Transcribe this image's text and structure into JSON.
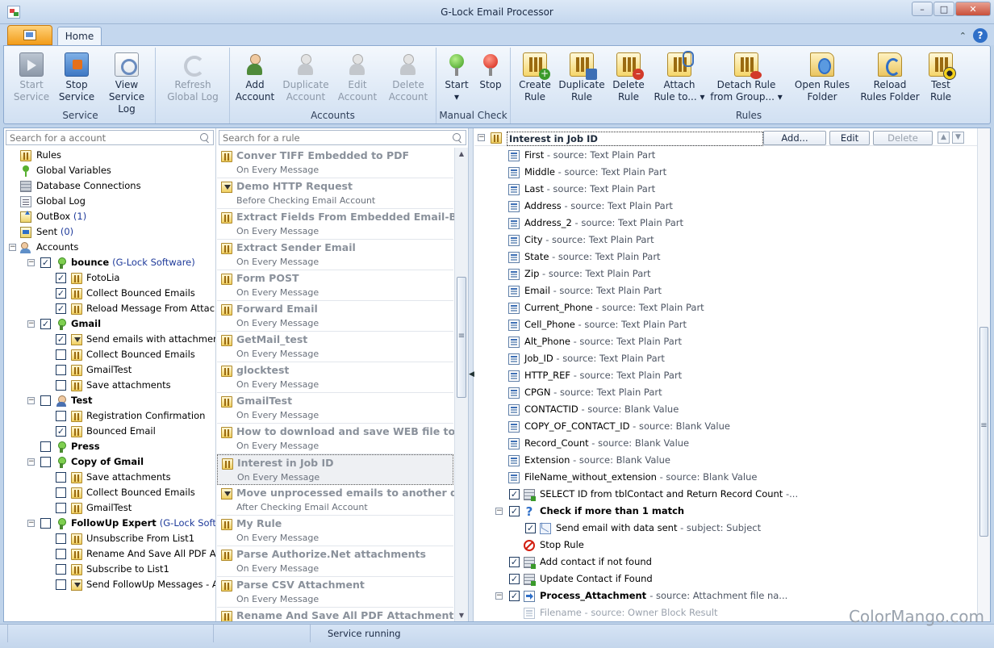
{
  "window": {
    "title": "G-Lock Email Processor",
    "controls": [
      "–",
      "□",
      "✕"
    ]
  },
  "ribbon": {
    "tab": "Home",
    "groups": [
      {
        "title": "Service",
        "buttons": [
          {
            "l1": "Start",
            "l2": "Service",
            "icon": "service-start-icon",
            "enabled": false
          },
          {
            "l1": "Stop",
            "l2": "Service",
            "icon": "service-stop-icon",
            "enabled": true
          },
          {
            "l1": "View",
            "l2": "Service Log",
            "icon": "log-icon",
            "enabled": true
          }
        ]
      },
      {
        "title": "",
        "buttons": [
          {
            "l1": "Refresh",
            "l2": "Global Log",
            "icon": "refresh-icon",
            "enabled": false
          }
        ]
      },
      {
        "title": "Accounts",
        "buttons": [
          {
            "l1": "Add",
            "l2": "Account",
            "icon": "add-account-icon",
            "enabled": true
          },
          {
            "l1": "Duplicate",
            "l2": "Account",
            "icon": "duplicate-account-icon",
            "enabled": false
          },
          {
            "l1": "Edit",
            "l2": "Account",
            "icon": "edit-account-icon",
            "enabled": false
          },
          {
            "l1": "Delete",
            "l2": "Account",
            "icon": "delete-account-icon",
            "enabled": false
          }
        ]
      },
      {
        "title": "Manual Check",
        "buttons": [
          {
            "l1": "Start",
            "l2": "▾",
            "icon": "start-check-icon",
            "enabled": true
          },
          {
            "l1": "Stop",
            "l2": "",
            "icon": "stop-check-icon",
            "enabled": true
          }
        ]
      },
      {
        "title": "Rules",
        "buttons": [
          {
            "l1": "Create",
            "l2": "Rule",
            "icon": "create-rule-icon",
            "enabled": true
          },
          {
            "l1": "Duplicate",
            "l2": "Rule",
            "icon": "duplicate-rule-icon",
            "enabled": true
          },
          {
            "l1": "Delete",
            "l2": "Rule",
            "icon": "delete-rule-icon",
            "enabled": true
          },
          {
            "l1": "Attach",
            "l2": "Rule to... ▾",
            "icon": "attach-rule-icon",
            "enabled": true
          },
          {
            "l1": "Detach Rule",
            "l2": "from Group... ▾",
            "icon": "detach-rule-icon",
            "enabled": true
          },
          {
            "l1": "Open Rules",
            "l2": "Folder",
            "icon": "open-rules-folder-icon",
            "enabled": true
          },
          {
            "l1": "Reload",
            "l2": "Rules Folder",
            "icon": "reload-rules-folder-icon",
            "enabled": true
          },
          {
            "l1": "Test",
            "l2": "Rule",
            "icon": "test-rule-icon",
            "enabled": true
          }
        ]
      }
    ]
  },
  "left_pane": {
    "search_placeholder": "Search for a account",
    "top_items": [
      {
        "label": "Rules",
        "icon": "rules-icon"
      },
      {
        "label": "Global Variables",
        "icon": "variables-icon"
      },
      {
        "label": "Database Connections",
        "icon": "database-icon"
      },
      {
        "label": "Global Log",
        "icon": "log-icon"
      },
      {
        "label": "OutBox",
        "count": "(1)",
        "icon": "outbox-icon"
      },
      {
        "label": "Sent",
        "count": "(0)",
        "icon": "sent-icon"
      },
      {
        "label": "Accounts",
        "icon": "accounts-icon"
      }
    ],
    "accounts": [
      {
        "name": "bounce",
        "owner": "(G-Lock Software)",
        "checked": true,
        "icon": "account-icon",
        "rules": [
          {
            "label": "FotoLia",
            "checked": true,
            "icon": "rule-icon"
          },
          {
            "label": "Collect Bounced Emails",
            "checked": true,
            "icon": "rule-icon"
          },
          {
            "label": "Reload Message From Attachmen",
            "checked": true,
            "icon": "rule-icon"
          }
        ]
      },
      {
        "name": "Gmail",
        "owner": "",
        "checked": true,
        "icon": "account-icon",
        "rules": [
          {
            "label": "Send emails with attachments",
            "checked": true,
            "icon": "download-rule-icon"
          },
          {
            "label": "Collect Bounced Emails",
            "checked": false,
            "icon": "rule-icon"
          },
          {
            "label": "GmailTest",
            "checked": false,
            "icon": "rule-icon"
          },
          {
            "label": "Save attachments",
            "checked": false,
            "icon": "rule-icon"
          }
        ]
      },
      {
        "name": "Test",
        "owner": "",
        "checked": false,
        "icon": "user-account-icon",
        "rules": [
          {
            "label": "Registration Confirmation",
            "checked": false,
            "icon": "rule-icon"
          },
          {
            "label": "Bounced Email",
            "checked": true,
            "icon": "rule-icon"
          }
        ]
      },
      {
        "name": "Press",
        "owner": "",
        "checked": false,
        "icon": "account-icon",
        "rules": []
      },
      {
        "name": "Copy of Gmail",
        "owner": "",
        "checked": false,
        "icon": "account-icon",
        "rules": [
          {
            "label": "Save attachments",
            "checked": false,
            "icon": "rule-icon"
          },
          {
            "label": "Collect Bounced Emails",
            "checked": false,
            "icon": "rule-icon"
          },
          {
            "label": "GmailTest",
            "checked": false,
            "icon": "rule-icon"
          }
        ]
      },
      {
        "name": "FollowUp Expert",
        "owner": "(G-Lock Softw...",
        "checked": false,
        "icon": "account-icon",
        "rules": [
          {
            "label": "Unsubscribe From List1",
            "checked": false,
            "icon": "rule-icon"
          },
          {
            "label": "Rename And Save All PDF Attach",
            "checked": false,
            "icon": "rule-icon"
          },
          {
            "label": "Subscribe to List1",
            "checked": false,
            "icon": "rule-icon"
          },
          {
            "label": "Send FollowUp Messages - AFTEI",
            "checked": false,
            "icon": "download-rule-icon"
          }
        ]
      }
    ]
  },
  "middle_pane": {
    "search_placeholder": "Search for a rule",
    "selected": "Interest in Job ID",
    "rules": [
      {
        "name": "Conver TIFF Embedded to PDF",
        "trigger": "On Every Message",
        "icon": "rule-icon"
      },
      {
        "name": "Demo HTTP Request",
        "trigger": "Before Checking Email Account",
        "icon": "download-rule-icon"
      },
      {
        "name": "Extract Fields From Embedded Email-Bo...",
        "trigger": "On Every Message",
        "icon": "rule-icon"
      },
      {
        "name": "Extract Sender Email",
        "trigger": "On Every Message",
        "icon": "rule-icon"
      },
      {
        "name": "Form POST",
        "trigger": "On Every Message",
        "icon": "rule-icon"
      },
      {
        "name": "Forward Email",
        "trigger": "On Every Message",
        "icon": "rule-icon"
      },
      {
        "name": "GetMail_test",
        "trigger": "On Every Message",
        "icon": "rule-icon"
      },
      {
        "name": "glocktest",
        "trigger": "On Every Message",
        "icon": "rule-icon"
      },
      {
        "name": "GmailTest",
        "trigger": "On Every Message",
        "icon": "rule-icon"
      },
      {
        "name": "How to download and save WEB file to ...",
        "trigger": "On Every Message",
        "icon": "rule-icon"
      },
      {
        "name": "Interest in Job ID",
        "trigger": "On Every Message",
        "icon": "rule-icon"
      },
      {
        "name": "Move unprocessed emails to another d...",
        "trigger": "After Checking Email Account",
        "icon": "download-rule-icon"
      },
      {
        "name": "My Rule",
        "trigger": "On Every Message",
        "icon": "rule-icon"
      },
      {
        "name": "Parse Authorize.Net attachments",
        "trigger": "On Every Message",
        "icon": "rule-icon"
      },
      {
        "name": "Parse CSV Attachment",
        "trigger": "On Every Message",
        "icon": "rule-icon"
      },
      {
        "name": "Rename And Save All PDF Attachment",
        "trigger": "",
        "icon": "rule-icon"
      }
    ]
  },
  "right_pane": {
    "rule_title": "Interest in Job ID",
    "buttons": {
      "add": "Add...",
      "edit": "Edit",
      "delete": "Delete"
    },
    "fields": [
      {
        "name": "First",
        "source": "- source: Text Plain Part"
      },
      {
        "name": "Middle",
        "source": "- source: Text Plain Part"
      },
      {
        "name": "Last",
        "source": "- source: Text Plain Part"
      },
      {
        "name": "Address",
        "source": "- source: Text Plain Part"
      },
      {
        "name": "Address_2",
        "source": "- source: Text Plain Part"
      },
      {
        "name": "City",
        "source": "- source: Text Plain Part"
      },
      {
        "name": "State",
        "source": "- source: Text Plain Part"
      },
      {
        "name": "Zip",
        "source": "- source: Text Plain Part"
      },
      {
        "name": "Email",
        "source": "- source: Text Plain Part"
      },
      {
        "name": "Current_Phone",
        "source": "- source: Text Plain Part"
      },
      {
        "name": "Cell_Phone",
        "source": "- source: Text Plain Part"
      },
      {
        "name": "Alt_Phone",
        "source": "- source: Text Plain Part"
      },
      {
        "name": "Job_ID",
        "source": "- source: Text Plain Part"
      },
      {
        "name": "HTTP_REF",
        "source": "- source: Text Plain Part"
      },
      {
        "name": "CPGN",
        "source": "- source: Text Plain Part"
      },
      {
        "name": "CONTACTID",
        "source": "- source: Blank Value"
      },
      {
        "name": "COPY_OF_CONTACT_ID",
        "source": "- source: Blank Value"
      },
      {
        "name": "Record_Count",
        "source": "- source: Blank Value"
      },
      {
        "name": "Extension",
        "source": "- source: Blank Value"
      },
      {
        "name": "FileName_without_extension",
        "source": "- source: Blank Value"
      }
    ],
    "actions": [
      {
        "label": "SELECT ID from tblContact and Return Record Count",
        "source": "-...",
        "checked": true,
        "bold": false,
        "icon": "sql-icon"
      },
      {
        "label": "Check if more than 1 match",
        "source": "",
        "checked": true,
        "bold": true,
        "icon": "question-icon"
      },
      {
        "label": "Send email with data sent",
        "source": "- subject: Subject",
        "checked": true,
        "bold": false,
        "icon": "mail-icon"
      },
      {
        "label": "Stop Rule",
        "source": "",
        "checked": null,
        "bold": false,
        "icon": "stop-icon"
      },
      {
        "label": "Add contact if not found",
        "source": "",
        "checked": true,
        "bold": false,
        "icon": "sql-icon"
      },
      {
        "label": "Update Contact if Found",
        "source": "",
        "checked": true,
        "bold": false,
        "icon": "sql-icon"
      },
      {
        "label": "Process_Attachment",
        "source": "- source: Attachment file na...",
        "checked": true,
        "bold": true,
        "icon": "arrow-icon"
      },
      {
        "label": "Filename",
        "source": "- source: Owner Block Result",
        "checked": null,
        "bold": false,
        "icon": "field-icon"
      }
    ]
  },
  "status": {
    "text": "Service running"
  },
  "watermark": "ColorMango.com"
}
